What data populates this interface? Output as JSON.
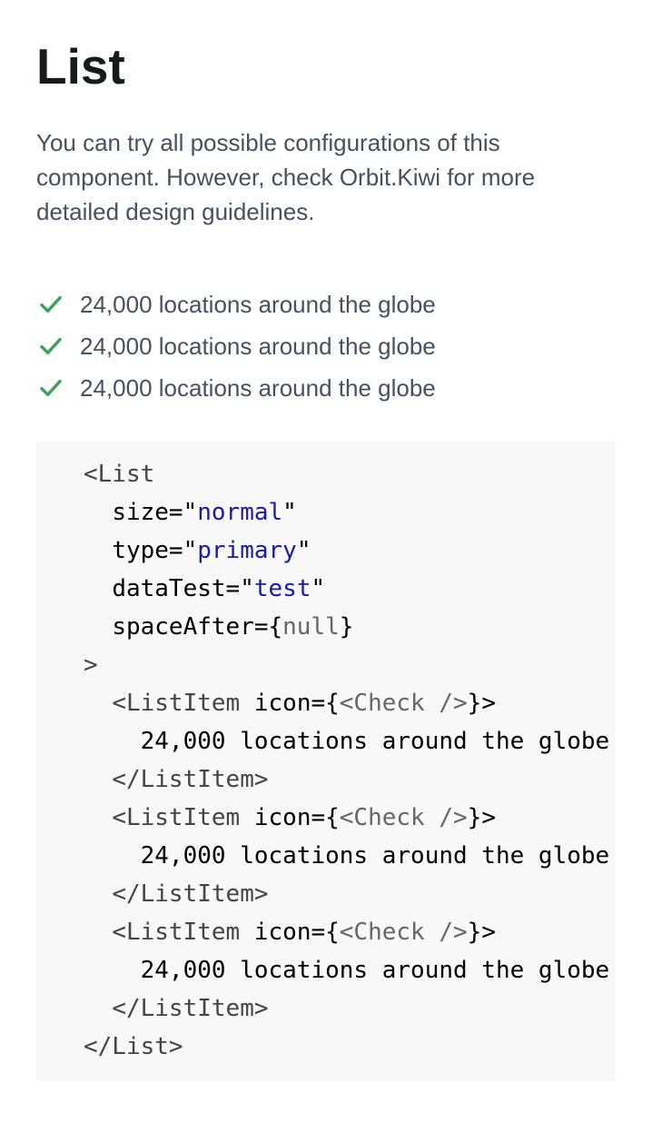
{
  "page": {
    "title": "List",
    "intro": "You can try all possible configurations of this component. However, check Orbit.Kiwi for more detailed design guidelines."
  },
  "list": {
    "icon": "check-icon",
    "icon_color": "#3da35a",
    "items": [
      {
        "label": "24,000 locations around the globe"
      },
      {
        "label": "24,000 locations around the globe"
      },
      {
        "label": "24,000 locations around the globe"
      }
    ]
  },
  "code": {
    "open_tag": "<List",
    "props": [
      {
        "name": "size=\"",
        "value": "normal",
        "close": "\""
      },
      {
        "name": "type=\"",
        "value": "primary",
        "close": "\""
      },
      {
        "name": "dataTest=\"",
        "value": "test",
        "close": "\""
      },
      {
        "name": "spaceAfter={",
        "value": "null",
        "close": "}"
      }
    ],
    "open_end": ">",
    "item_tag_open": "<ListItem",
    "item_attr": " icon={",
    "item_icon": "<Check />",
    "item_attr_close": "}>",
    "item_text": "24,000 locations around the globe",
    "item_tag_close": "</ListItem>",
    "close_tag": "</List>"
  }
}
